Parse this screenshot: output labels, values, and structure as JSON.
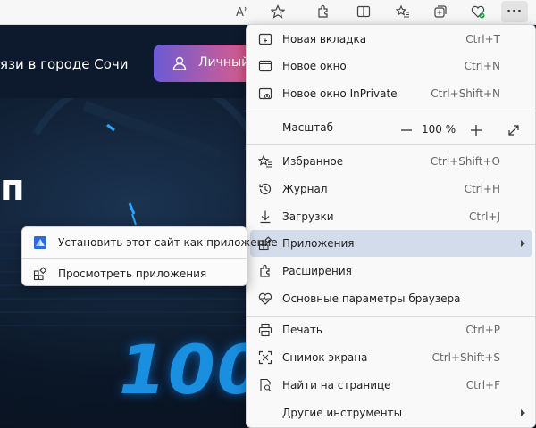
{
  "page": {
    "header_text": "язи в городе Сочи",
    "personal_button": "Личный",
    "hero_title": "п",
    "hero_number": "100"
  },
  "toolbar": {
    "icons": [
      "read-aloud-icon",
      "favorite-star-icon",
      "extensions-icon",
      "split-screen-icon",
      "favorites-icon",
      "collections-icon",
      "browser-essentials-icon",
      "more-menu-icon"
    ],
    "more_label": "···"
  },
  "menu": {
    "items": [
      {
        "label": "Новая вкладка",
        "shortcut": "Ctrl+T"
      },
      {
        "label": "Новое окно",
        "shortcut": "Ctrl+N"
      },
      {
        "label": "Новое окно InPrivate",
        "shortcut": "Ctrl+Shift+N"
      },
      {
        "label": "Масштаб",
        "zoom": "100 %"
      },
      {
        "label": "Избранное",
        "shortcut": "Ctrl+Shift+O"
      },
      {
        "label": "Журнал",
        "shortcut": "Ctrl+H"
      },
      {
        "label": "Загрузки",
        "shortcut": "Ctrl+J"
      },
      {
        "label": "Приложения"
      },
      {
        "label": "Расширения"
      },
      {
        "label": "Основные параметры браузера"
      },
      {
        "label": "Печать",
        "shortcut": "Ctrl+P"
      },
      {
        "label": "Снимок экрана",
        "shortcut": "Ctrl+Shift+S"
      },
      {
        "label": "Найти на странице",
        "shortcut": "Ctrl+F"
      },
      {
        "label": "Другие инструменты"
      }
    ]
  },
  "submenu": {
    "items": [
      {
        "label": "Установить этот сайт как приложение"
      },
      {
        "label": "Просмотреть приложения"
      }
    ]
  },
  "colors": {
    "highlight": "#d3dcea",
    "accent": "#1a8fe0"
  }
}
